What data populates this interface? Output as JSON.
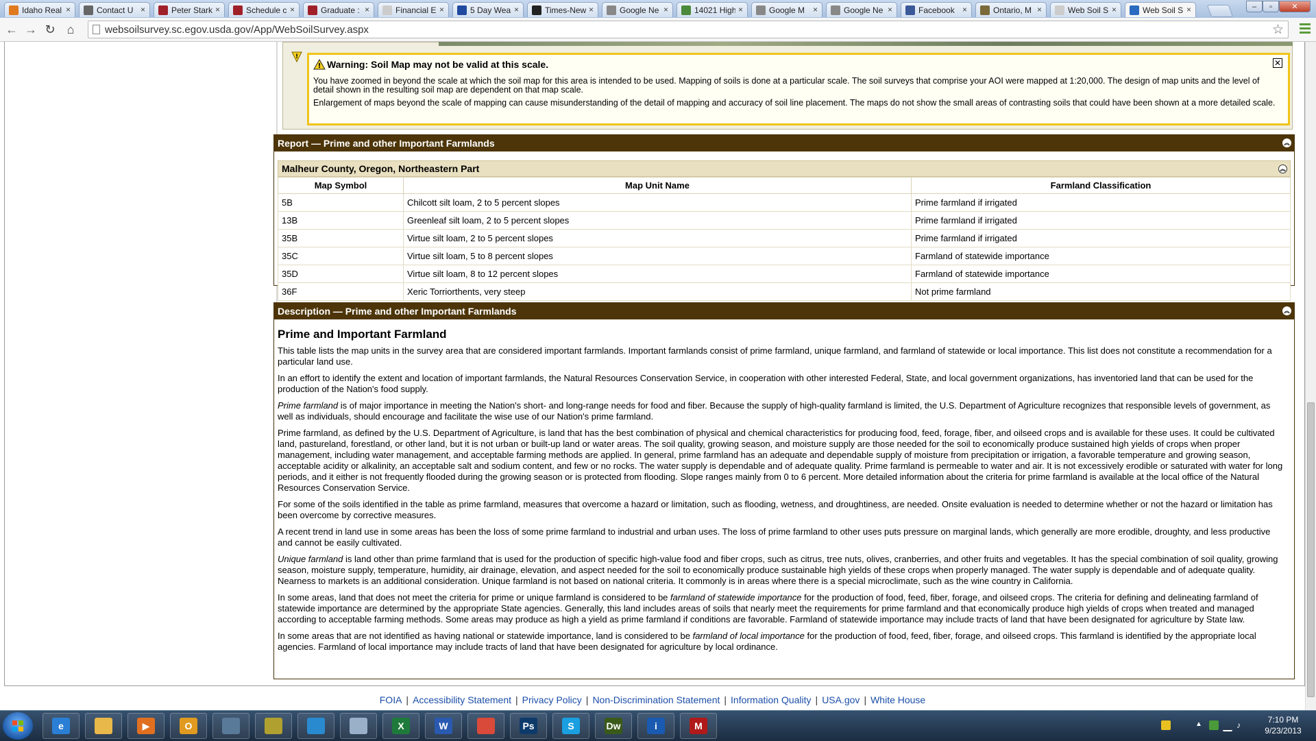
{
  "browser": {
    "tabs": [
      {
        "title": "Idaho Real",
        "icon_color": "#e07a1f",
        "icon": "home-icon"
      },
      {
        "title": "Contact U",
        "icon_color": "#666666",
        "icon": "globe-icon"
      },
      {
        "title": "Peter Stark",
        "icon_color": "#a0202a",
        "icon": "usc-icon"
      },
      {
        "title": "Schedule c",
        "icon_color": "#a0202a",
        "icon": "usc-icon"
      },
      {
        "title": "Graduate :",
        "icon_color": "#a0202a",
        "icon": "usc-icon"
      },
      {
        "title": "Financial E",
        "icon_color": "#cccccc",
        "icon": "page-icon"
      },
      {
        "title": "5 Day Wea",
        "icon_color": "#1f4aa0",
        "icon": "twc-icon"
      },
      {
        "title": "Times-New",
        "icon_color": "#222222",
        "icon": "mv-icon"
      },
      {
        "title": "Google Ne",
        "icon_color": "#888888",
        "icon": "news-icon"
      },
      {
        "title": "14021 High",
        "icon_color": "#4a8a3a",
        "icon": "map-icon"
      },
      {
        "title": "Google M",
        "icon_color": "#888888",
        "icon": "maps-icon"
      },
      {
        "title": "Google Ne",
        "icon_color": "#888888",
        "icon": "news-icon"
      },
      {
        "title": "Facebook",
        "icon_color": "#3b5998",
        "icon": "facebook-icon"
      },
      {
        "title": "Ontario, M",
        "icon_color": "#7a6a3a",
        "icon": "page-icon"
      },
      {
        "title": "Web Soil S",
        "icon_color": "#cccccc",
        "icon": "page-icon"
      },
      {
        "title": "Web Soil S",
        "icon_color": "#2a6ac0",
        "icon": "usda-icon",
        "active": true
      }
    ],
    "url": "websoilsurvey.sc.egov.usda.gov/App/WebSoilSurvey.aspx"
  },
  "warning": {
    "title": "Warning: Soil Map may not be valid at this scale.",
    "p1": "You have zoomed in beyond the scale at which the soil map for this area is intended to be used. Mapping of soils is done at a particular scale. The soil surveys that comprise your AOI were mapped at 1:20,000. The design of map units and the level of detail shown in the resulting soil map are dependent on that map scale.",
    "p2": "Enlargement of maps beyond the scale of mapping can cause misunderstanding of the detail of mapping and accuracy of soil line placement. The maps do not show the small areas of contrasting soils that could have been shown at a more detailed scale.",
    "close_label": "✕"
  },
  "report": {
    "header": "Report — Prime and other Important Farmlands",
    "county": "Malheur County, Oregon, Northeastern Part",
    "columns": [
      "Map Symbol",
      "Map Unit Name",
      "Farmland Classification"
    ],
    "rows": [
      [
        "5B",
        "Chilcott silt loam, 2 to 5 percent slopes",
        "Prime farmland if irrigated"
      ],
      [
        "13B",
        "Greenleaf silt loam, 2 to 5 percent slopes",
        "Prime farmland if irrigated"
      ],
      [
        "35B",
        "Virtue silt loam, 2 to 5 percent slopes",
        "Prime farmland if irrigated"
      ],
      [
        "35C",
        "Virtue silt loam, 5 to 8 percent slopes",
        "Farmland of statewide importance"
      ],
      [
        "35D",
        "Virtue silt loam, 8 to 12 percent slopes",
        "Farmland of statewide importance"
      ],
      [
        "36F",
        "Xeric Torriorthents, very steep",
        "Not prime farmland"
      ]
    ]
  },
  "description": {
    "header": "Description — Prime and other Important Farmlands",
    "title": "Prime and Important Farmland",
    "p1": "This table lists the map units in the survey area that are considered important farmlands. Important farmlands consist of prime farmland, unique farmland, and farmland of statewide or local importance. This list does not constitute a recommendation for a particular land use.",
    "p2": "In an effort to identify the extent and location of important farmlands, the Natural Resources Conservation Service, in cooperation with other interested Federal, State, and local government organizations, has inventoried land that can be used for the production of the Nation's food supply.",
    "p3_em": "Prime farmland",
    "p3": " is of major importance in meeting the Nation's short- and long-range needs for food and fiber. Because the supply of high-quality farmland is limited, the U.S. Department of Agriculture recognizes that responsible levels of government, as well as individuals, should encourage and facilitate the wise use of our Nation's prime farmland.",
    "p4": "Prime farmland, as defined by the U.S. Department of Agriculture, is land that has the best combination of physical and chemical characteristics for producing food, feed, forage, fiber, and oilseed crops and is available for these uses. It could be cultivated land, pastureland, forestland, or other land, but it is not urban or built-up land or water areas. The soil quality, growing season, and moisture supply are those needed for the soil to economically produce sustained high yields of crops when proper management, including water management, and acceptable farming methods are applied. In general, prime farmland has an adequate and dependable supply of moisture from precipitation or irrigation, a favorable temperature and growing season, acceptable acidity or alkalinity, an acceptable salt and sodium content, and few or no rocks. The water supply is dependable and of adequate quality. Prime farmland is permeable to water and air. It is not excessively erodible or saturated with water for long periods, and it either is not frequently flooded during the growing season or is protected from flooding. Slope ranges mainly from 0 to 6 percent. More detailed information about the criteria for prime farmland is available at the local office of the Natural Resources Conservation Service.",
    "p5": "For some of the soils identified in the table as prime farmland, measures that overcome a hazard or limitation, such as flooding, wetness, and droughtiness, are needed. Onsite evaluation is needed to determine whether or not the hazard or limitation has been overcome by corrective measures.",
    "p6": "A recent trend in land use in some areas has been the loss of some prime farmland to industrial and urban uses. The loss of prime farmland to other uses puts pressure on marginal lands, which generally are more erodible, droughty, and less productive and cannot be easily cultivated.",
    "p7_em": "Unique farmland",
    "p7": " is land other than prime farmland that is used for the production of specific high-value food and fiber crops, such as citrus, tree nuts, olives, cranberries, and other fruits and vegetables. It has the special combination of soil quality, growing season, moisture supply, temperature, humidity, air drainage, elevation, and aspect needed for the soil to economically produce sustainable high yields of these crops when properly managed. The water supply is dependable and of adequate quality. Nearness to markets is an additional consideration. Unique farmland is not based on national criteria. It commonly is in areas where there is a special microclimate, such as the wine country in California.",
    "p8_a": "In some areas, land that does not meet the criteria for prime or unique farmland is considered to be ",
    "p8_em": "farmland of statewide importance",
    "p8_b": " for the production of food, feed, fiber, forage, and oilseed crops. The criteria for defining and delineating farmland of statewide importance are determined by the appropriate State agencies. Generally, this land includes areas of soils that nearly meet the requirements for prime farmland and that economically produce high yields of crops when treated and managed according to acceptable farming methods. Some areas may produce as high a yield as prime farmland if conditions are favorable. Farmland of statewide importance may include tracts of land that have been designated for agriculture by State law.",
    "p9_a": "In some areas that are not identified as having national or statewide importance, land is considered to be ",
    "p9_em": "farmland of local importance",
    "p9_b": " for the production of food, feed, fiber, forage, and oilseed crops. This farmland is identified by the appropriate local agencies. Farmland of local importance may include tracts of land that have been designated for agriculture by local ordinance."
  },
  "footer": {
    "links": [
      "FOIA",
      "Accessibility Statement",
      "Privacy Policy",
      "Non-Discrimination Statement",
      "Information Quality",
      "USA.gov",
      "White House"
    ],
    "separator": "|"
  },
  "taskbar": {
    "items": [
      {
        "name": "ie-taskbar-button",
        "label": "e",
        "color": "#2a7fd4"
      },
      {
        "name": "explorer-taskbar-button",
        "label": "",
        "color": "#e8b84a"
      },
      {
        "name": "media-player-taskbar-button",
        "label": "▶",
        "color": "#e07020"
      },
      {
        "name": "outlook-taskbar-button",
        "label": "O",
        "color": "#e09a20"
      },
      {
        "name": "app-taskbar-button-1",
        "label": "",
        "color": "#5a7a9a"
      },
      {
        "name": "app-taskbar-button-2",
        "label": "",
        "color": "#b0a030"
      },
      {
        "name": "app-taskbar-button-3",
        "label": "",
        "color": "#2a8ad0"
      },
      {
        "name": "notepad-taskbar-button",
        "label": "",
        "color": "#9ab0c8"
      },
      {
        "name": "excel-taskbar-button",
        "label": "X",
        "color": "#1e7a3a"
      },
      {
        "name": "word-taskbar-button",
        "label": "W",
        "color": "#2a5ab0"
      },
      {
        "name": "chrome-taskbar-button",
        "label": "",
        "color": "#d94a3a"
      },
      {
        "name": "photoshop-taskbar-button",
        "label": "Ps",
        "color": "#0e3a6a"
      },
      {
        "name": "skype-taskbar-button",
        "label": "S",
        "color": "#1aa0e0"
      },
      {
        "name": "dreamweaver-taskbar-button",
        "label": "Dw",
        "color": "#3a5a1a"
      },
      {
        "name": "info-taskbar-button",
        "label": "i",
        "color": "#1a5ab0"
      },
      {
        "name": "mcafee-taskbar-button",
        "label": "M",
        "color": "#b01a1a"
      }
    ],
    "time": "7:10 PM",
    "date": "9/23/2013"
  }
}
